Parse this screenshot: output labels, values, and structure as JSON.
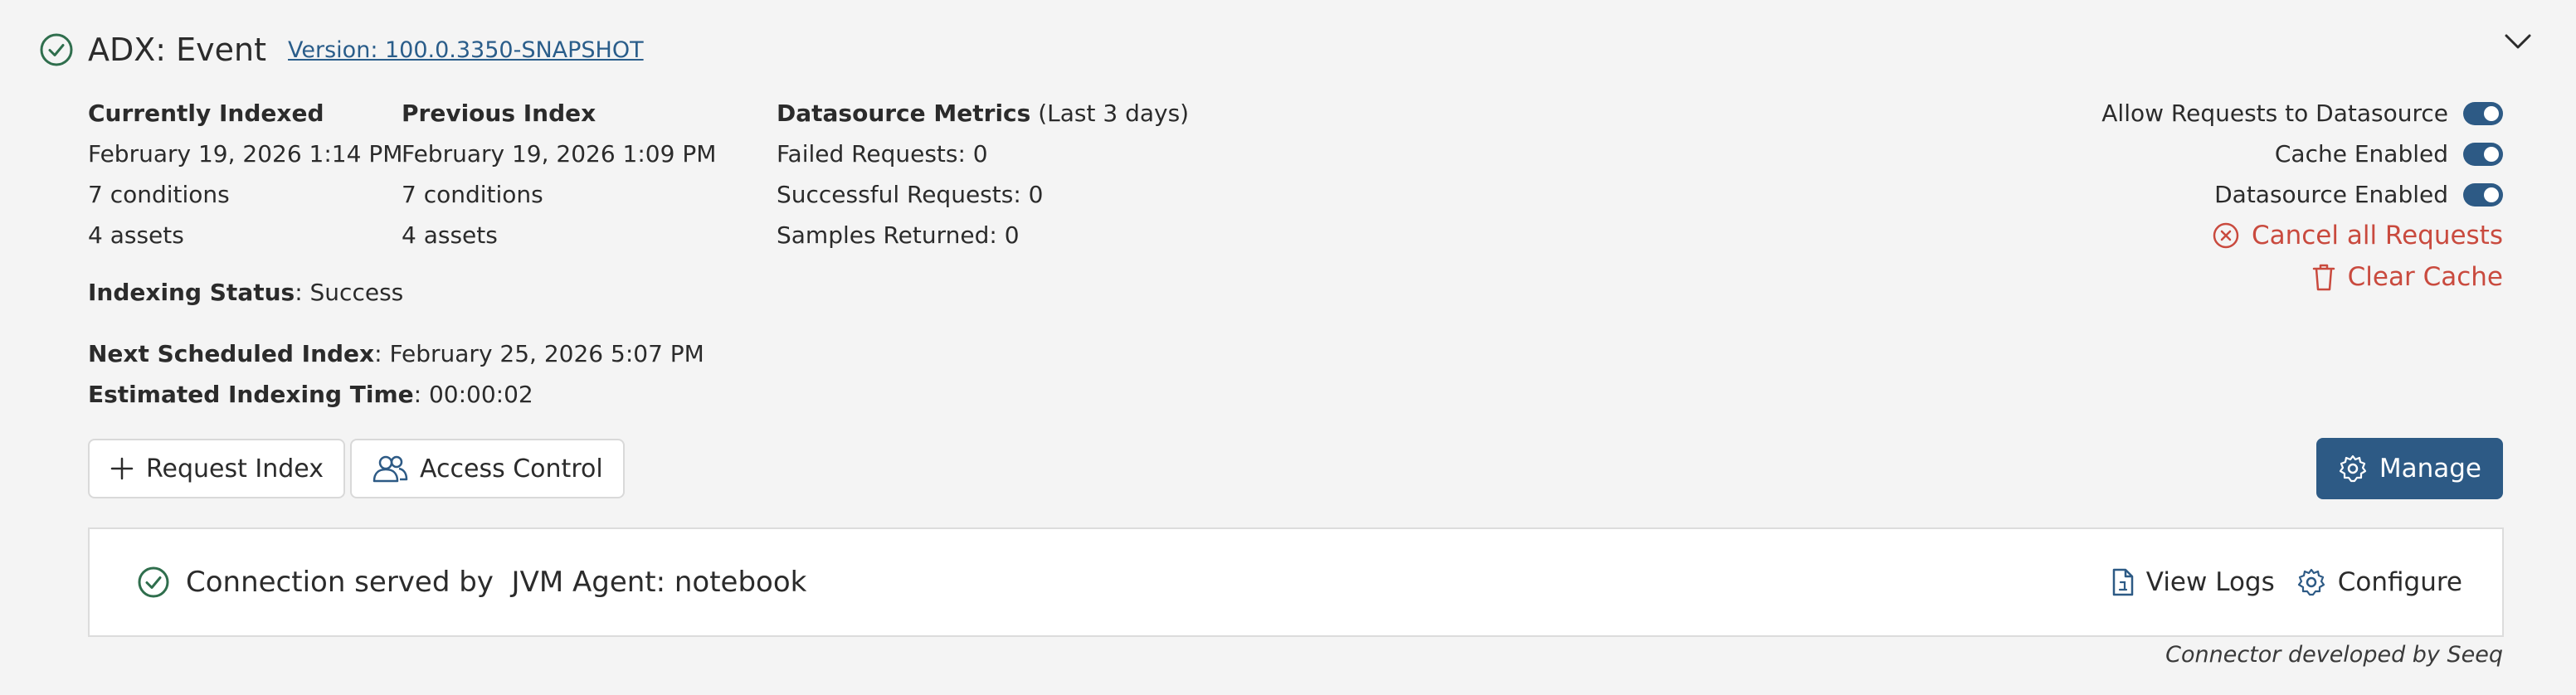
{
  "header": {
    "title": "ADX: Event",
    "version": "Version: 100.0.3350-SNAPSHOT"
  },
  "index": {
    "current_heading": "Currently Indexed",
    "current_date": "February 19, 2026 1:14 PM",
    "current_conditions": "7 conditions",
    "current_assets": "4 assets",
    "previous_heading": "Previous Index",
    "previous_date": "February 19, 2026 1:09 PM",
    "previous_conditions": "7 conditions",
    "previous_assets": "4 assets"
  },
  "metrics": {
    "heading": "Datasource Metrics",
    "period": " (Last 3 days)",
    "failed": "Failed Requests: 0",
    "successful": "Successful Requests: 0",
    "samples": "Samples Returned: 0"
  },
  "status": {
    "indexing_label": "Indexing Status",
    "indexing_value": ": Success",
    "next_label": "Next Scheduled Index",
    "next_value": ": February 25, 2026 5:07 PM",
    "estimate_label": "Estimated Indexing Time",
    "estimate_value": ": 00:00:02"
  },
  "toggles": {
    "allow_requests": "Allow Requests to Datasource",
    "cache_enabled": "Cache Enabled",
    "datasource_enabled": "Datasource Enabled"
  },
  "actions": {
    "cancel_requests": "Cancel all Requests",
    "clear_cache": "Clear Cache"
  },
  "buttons": {
    "request_index": "Request Index",
    "access_control": "Access Control",
    "manage": "Manage"
  },
  "connection": {
    "text": "Connection served by  JVM Agent: notebook",
    "view_logs": "View Logs",
    "configure": "Configure"
  },
  "footer": "Connector developed by Seeq",
  "colors": {
    "accent": "#2d5a85",
    "danger": "#c94a3e",
    "success": "#2f6e4d",
    "background": "#f4f4f4"
  }
}
